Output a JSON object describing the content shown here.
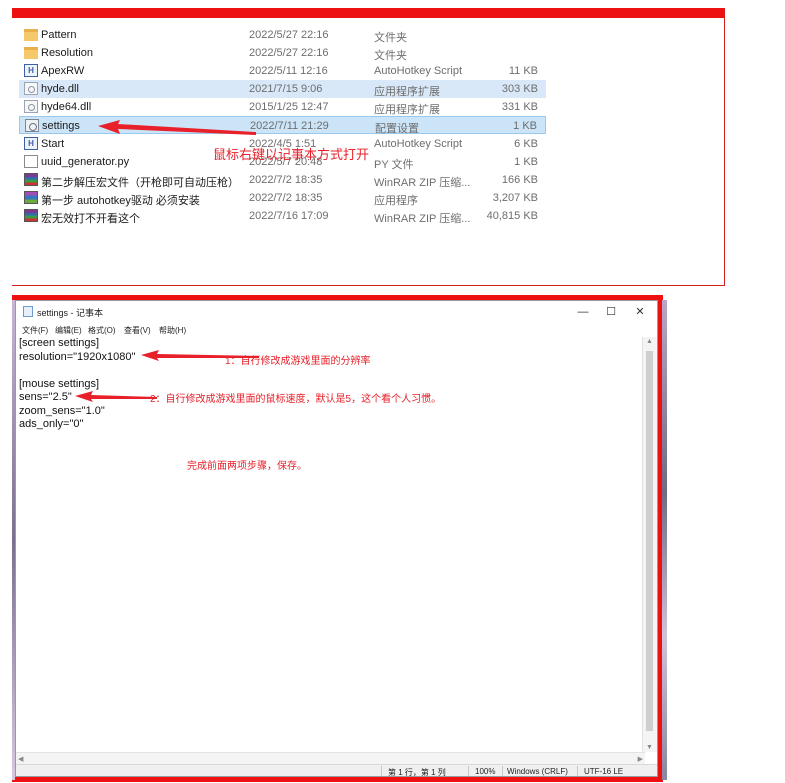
{
  "explorer": {
    "files": [
      {
        "name": "Pattern",
        "date": "2022/5/27 22:16",
        "type": "文件夹",
        "size": "",
        "icon": "folder-icon"
      },
      {
        "name": "Resolution",
        "date": "2022/5/27 22:16",
        "type": "文件夹",
        "size": "",
        "icon": "folder-icon"
      },
      {
        "name": "ApexRW",
        "date": "2022/5/11 12:16",
        "type": "AutoHotkey Script",
        "size": "11 KB",
        "icon": "ahk-script-icon"
      },
      {
        "name": "hyde.dll",
        "date": "2021/7/15 9:06",
        "type": "应用程序扩展",
        "size": "303 KB",
        "icon": "dll-icon"
      },
      {
        "name": "hyde64.dll",
        "date": "2015/1/25 12:47",
        "type": "应用程序扩展",
        "size": "331 KB",
        "icon": "dll-icon"
      },
      {
        "name": "settings",
        "date": "2022/7/11 21:29",
        "type": "配置设置",
        "size": "1 KB",
        "icon": "settings-file-icon"
      },
      {
        "name": "Start",
        "date": "2022/4/5 1:51",
        "type": "AutoHotkey Script",
        "size": "6 KB",
        "icon": "ahk-script-icon"
      },
      {
        "name": "uuid_generator.py",
        "date": "2022/5/7 20:48",
        "type": "PY 文件",
        "size": "1 KB",
        "icon": "python-file-icon"
      },
      {
        "name": "第二步解压宏文件（开枪即可自动压枪）",
        "date": "2022/7/2 18:35",
        "type": "WinRAR ZIP 压缩...",
        "size": "166 KB",
        "icon": "winrar-archive-icon"
      },
      {
        "name": "第一步 autohotkey驱动 必须安装",
        "date": "2022/7/2 18:35",
        "type": "应用程序",
        "size": "3,207 KB",
        "icon": "installer-icon"
      },
      {
        "name": "宏无效打不开看这个",
        "date": "2022/7/16 17:09",
        "type": "WinRAR ZIP 压缩...",
        "size": "40,815 KB",
        "icon": "winrar-archive-icon"
      }
    ],
    "annotation": "鼠标右键以记事本方式打开"
  },
  "notepad": {
    "title": "settings - 记事本",
    "window_buttons": {
      "minimize": "—",
      "maximize": "☐",
      "close": "✕"
    },
    "menu": [
      "文件(F)",
      "编辑(E)",
      "格式(O)",
      "查看(V)",
      "帮助(H)"
    ],
    "lines": [
      "[screen settings]",
      "resolution=\"1920x1080\"",
      "",
      "[mouse settings]",
      "sens=\"2.5\"",
      "zoom_sens=\"1.0\"",
      "ads_only=\"0\""
    ],
    "annotations": {
      "a1": "1：自行修改成游戏里面的分辨率",
      "a2": "2：自行修改成游戏里面的鼠标速度，默认是5，这个看个人习惯。",
      "a3": "完成前面两项步骤，保存。"
    },
    "status": {
      "position": "第 1 行，第 1 列",
      "zoom": "100%",
      "line_ending": "Windows (CRLF)",
      "encoding": "UTF-16 LE"
    }
  },
  "colors": {
    "annotation_red": "#e8202a",
    "selection_blue": "#cce4f7"
  }
}
